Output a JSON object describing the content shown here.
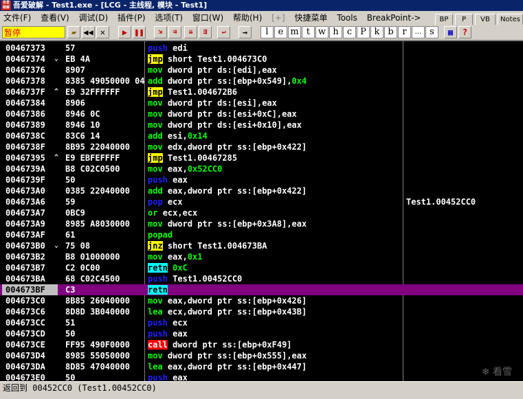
{
  "window": {
    "title": "吾爱破解 - Test1.exe - [LCG - 主线程, 模块 - Test1]"
  },
  "menu": {
    "items": [
      {
        "label": "文件(F)"
      },
      {
        "label": "查看(V)"
      },
      {
        "label": "调试(D)"
      },
      {
        "label": "插件(P)"
      },
      {
        "label": "选项(T)"
      },
      {
        "label": "窗口(W)"
      },
      {
        "label": "帮助(H)"
      },
      {
        "label": "[+]"
      },
      {
        "label": "快捷菜单"
      },
      {
        "label": "Tools"
      },
      {
        "label": "BreakPoint->"
      }
    ],
    "right_buttons": [
      "BP",
      "P",
      "VB",
      "Notes"
    ]
  },
  "toolbar": {
    "status": "暂停",
    "letters": [
      "l",
      "e",
      "m",
      "t",
      "w",
      "h",
      "c",
      "P",
      "k",
      "b",
      "r",
      "...",
      "s"
    ]
  },
  "disasm": {
    "rows": [
      {
        "addr": "00467373",
        "arrow": "",
        "hex": "57",
        "mnem": "push",
        "kind": "push",
        "ops": [
          [
            "edi",
            "reg"
          ]
        ],
        "comment": ""
      },
      {
        "addr": "00467374",
        "arrow": "⌄",
        "hex": "EB 4A",
        "mnem": "jmp",
        "kind": "jmp",
        "ops": [
          [
            "short Test1.004673C0",
            "reg"
          ]
        ],
        "comment": ""
      },
      {
        "addr": "00467376",
        "arrow": "",
        "hex": "8907",
        "mnem": "mov",
        "kind": "mov",
        "ops": [
          [
            "dword ptr ds:[edi],eax",
            "reg"
          ]
        ],
        "comment": ""
      },
      {
        "addr": "00467378",
        "arrow": "",
        "hex": "8385 49050000 04",
        "mnem": "add",
        "kind": "mov",
        "ops": [
          [
            "dword ptr ss:[ebp+0x549],",
            "reg"
          ],
          [
            "0x4",
            "num"
          ]
        ],
        "comment": ""
      },
      {
        "addr": "0046737F",
        "arrow": "^",
        "hex": "E9 32FFFFFF",
        "mnem": "jmp",
        "kind": "jmp",
        "ops": [
          [
            "Test1.004672B6",
            "reg"
          ]
        ],
        "comment": ""
      },
      {
        "addr": "00467384",
        "arrow": "",
        "hex": "8906",
        "mnem": "mov",
        "kind": "mov",
        "ops": [
          [
            "dword ptr ds:[esi],eax",
            "reg"
          ]
        ],
        "comment": ""
      },
      {
        "addr": "00467386",
        "arrow": "",
        "hex": "8946 0C",
        "mnem": "mov",
        "kind": "mov",
        "ops": [
          [
            "dword ptr ds:[esi+0xC],eax",
            "reg"
          ]
        ],
        "comment": ""
      },
      {
        "addr": "00467389",
        "arrow": "",
        "hex": "8946 10",
        "mnem": "mov",
        "kind": "mov",
        "ops": [
          [
            "dword ptr ds:[esi+0x10],eax",
            "reg"
          ]
        ],
        "comment": ""
      },
      {
        "addr": "0046738C",
        "arrow": "",
        "hex": "83C6 14",
        "mnem": "add",
        "kind": "mov",
        "ops": [
          [
            "esi,",
            "reg"
          ],
          [
            "0x14",
            "num"
          ]
        ],
        "comment": ""
      },
      {
        "addr": "0046738F",
        "arrow": "",
        "hex": "8B95 22040000",
        "mnem": "mov",
        "kind": "mov",
        "ops": [
          [
            "edx,dword ptr ss:[ebp+0x422]",
            "reg"
          ]
        ],
        "comment": ""
      },
      {
        "addr": "00467395",
        "arrow": "^",
        "hex": "E9 EBFEFFFF",
        "mnem": "jmp",
        "kind": "jmp",
        "ops": [
          [
            "Test1.00467285",
            "reg"
          ]
        ],
        "comment": ""
      },
      {
        "addr": "0046739A",
        "arrow": "",
        "hex": "B8 C02C0500",
        "mnem": "mov",
        "kind": "mov",
        "ops": [
          [
            "eax,",
            "reg"
          ],
          [
            "0x52CC0",
            "num"
          ]
        ],
        "comment": ""
      },
      {
        "addr": "0046739F",
        "arrow": "",
        "hex": "50",
        "mnem": "push",
        "kind": "push",
        "ops": [
          [
            "eax",
            "reg"
          ]
        ],
        "comment": ""
      },
      {
        "addr": "004673A0",
        "arrow": "",
        "hex": "0385 22040000",
        "mnem": "add",
        "kind": "mov",
        "ops": [
          [
            "eax,dword ptr ss:[ebp+0x422]",
            "reg"
          ]
        ],
        "comment": ""
      },
      {
        "addr": "004673A6",
        "arrow": "",
        "hex": "59",
        "mnem": "pop",
        "kind": "pop",
        "ops": [
          [
            "ecx",
            "reg"
          ]
        ],
        "comment": "Test1.00452CC0"
      },
      {
        "addr": "004673A7",
        "arrow": "",
        "hex": "0BC9",
        "mnem": "or",
        "kind": "mov",
        "ops": [
          [
            "ecx,ecx",
            "reg"
          ]
        ],
        "comment": ""
      },
      {
        "addr": "004673A9",
        "arrow": "",
        "hex": "8985 A8030000",
        "mnem": "mov",
        "kind": "mov",
        "ops": [
          [
            "dword ptr ss:[ebp+0x3A8],eax",
            "reg"
          ]
        ],
        "comment": ""
      },
      {
        "addr": "004673AF",
        "arrow": "",
        "hex": "61",
        "mnem": "popad",
        "kind": "mov",
        "ops": [],
        "comment": ""
      },
      {
        "addr": "004673B0",
        "arrow": "⌄",
        "hex": "75 08",
        "mnem": "jnz",
        "kind": "jmp",
        "ops": [
          [
            "short Test1.004673BA",
            "reg"
          ]
        ],
        "comment": ""
      },
      {
        "addr": "004673B2",
        "arrow": "",
        "hex": "B8 01000000",
        "mnem": "mov",
        "kind": "mov",
        "ops": [
          [
            "eax,",
            "reg"
          ],
          [
            "0x1",
            "num"
          ]
        ],
        "comment": ""
      },
      {
        "addr": "004673B7",
        "arrow": "",
        "hex": "C2 0C00",
        "mnem": "retn",
        "kind": "retn",
        "ops": [
          [
            "0xC",
            "num"
          ]
        ],
        "comment": ""
      },
      {
        "addr": "004673BA",
        "arrow": "",
        "hex": "68 C02C4500",
        "mnem": "push",
        "kind": "push",
        "ops": [
          [
            "Test1.00452CC0",
            "reg"
          ]
        ],
        "comment": ""
      },
      {
        "addr": "004673BF",
        "arrow": "",
        "hex": "C3",
        "mnem": "retn",
        "kind": "retn",
        "ops": [],
        "comment": "",
        "selected": true
      },
      {
        "addr": "004673C0",
        "arrow": "",
        "hex": "8B85 26040000",
        "mnem": "mov",
        "kind": "mov",
        "ops": [
          [
            "eax,dword ptr ss:[ebp+0x426]",
            "reg"
          ]
        ],
        "comment": ""
      },
      {
        "addr": "004673C6",
        "arrow": "",
        "hex": "8D8D 3B040000",
        "mnem": "lea",
        "kind": "mov",
        "ops": [
          [
            "ecx,dword ptr ss:[ebp+0x43B]",
            "reg"
          ]
        ],
        "comment": ""
      },
      {
        "addr": "004673CC",
        "arrow": "",
        "hex": "51",
        "mnem": "push",
        "kind": "push",
        "ops": [
          [
            "ecx",
            "reg"
          ]
        ],
        "comment": ""
      },
      {
        "addr": "004673CD",
        "arrow": "",
        "hex": "50",
        "mnem": "push",
        "kind": "push",
        "ops": [
          [
            "eax",
            "reg"
          ]
        ],
        "comment": ""
      },
      {
        "addr": "004673CE",
        "arrow": "",
        "hex": "FF95 490F0000",
        "mnem": "call",
        "kind": "call",
        "ops": [
          [
            "dword ptr ss:[ebp+0xF49]",
            "reg"
          ]
        ],
        "comment": ""
      },
      {
        "addr": "004673D4",
        "arrow": "",
        "hex": "8985 55050000",
        "mnem": "mov",
        "kind": "mov",
        "ops": [
          [
            "dword ptr ss:[ebp+0x555],eax",
            "reg"
          ]
        ],
        "comment": ""
      },
      {
        "addr": "004673DA",
        "arrow": "",
        "hex": "8D85 47040000",
        "mnem": "lea",
        "kind": "mov",
        "ops": [
          [
            "eax,dword ptr ss:[ebp+0x447]",
            "reg"
          ]
        ],
        "comment": ""
      },
      {
        "addr": "004673E0",
        "arrow": "",
        "hex": "50",
        "mnem": "push",
        "kind": "push",
        "ops": [
          [
            "eax",
            "reg"
          ]
        ],
        "comment": ""
      }
    ]
  },
  "watermark": "看雪",
  "statusbar": {
    "label": "返回到",
    "text": " 00452CC0 (Test1.00452CC0)"
  }
}
